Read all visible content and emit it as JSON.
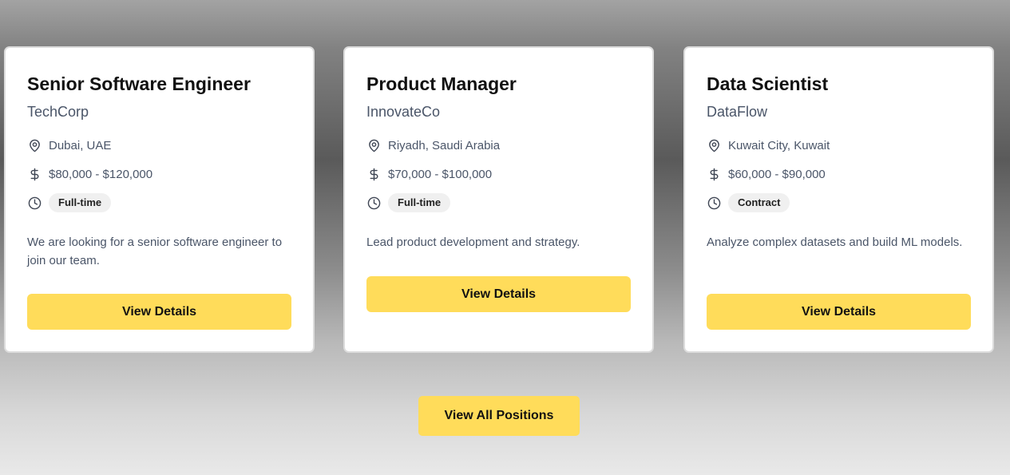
{
  "jobs": [
    {
      "title": "Senior Software Engineer",
      "company": "TechCorp",
      "location": "Dubai, UAE",
      "salary": "$80,000 - $120,000",
      "type": "Full-time",
      "description": "We are looking for a senior software engineer to join our team.",
      "button_label": "View Details"
    },
    {
      "title": "Product Manager",
      "company": "InnovateCo",
      "location": "Riyadh, Saudi Arabia",
      "salary": "$70,000 - $100,000",
      "type": "Full-time",
      "description": "Lead product development and strategy.",
      "button_label": "View Details"
    },
    {
      "title": "Data Scientist",
      "company": "DataFlow",
      "location": "Kuwait City, Kuwait",
      "salary": "$60,000 - $90,000",
      "type": "Contract",
      "description": "Analyze complex datasets and build ML models.",
      "button_label": "View Details"
    }
  ],
  "icons": {
    "location": "map-pin-icon",
    "salary": "dollar-icon",
    "type": "clock-icon"
  },
  "colors": {
    "accent": "#ffdc5a",
    "card_bg": "#ffffff",
    "muted_text": "#4a5568",
    "badge_bg": "#f0f0f0"
  },
  "footer": {
    "view_all_label": "View All Positions"
  }
}
